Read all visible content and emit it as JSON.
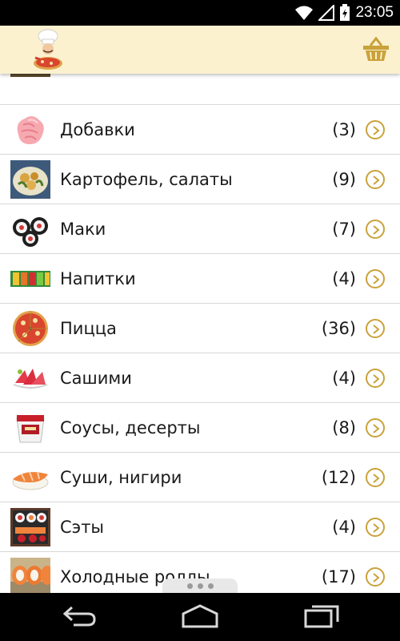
{
  "status_bar": {
    "time": "23:05",
    "icons": [
      "wifi-icon",
      "signal-icon",
      "battery-charging-icon"
    ]
  },
  "app_bar": {
    "logo_icon": "chef-pizza-logo",
    "action_icon": "basket-icon"
  },
  "categories": [
    {
      "name": "Добавки",
      "count": "(3)",
      "icon": "pickled-ginger-icon"
    },
    {
      "name": "Картофель, салаты",
      "count": "(9)",
      "icon": "potato-salad-icon"
    },
    {
      "name": "Маки",
      "count": "(7)",
      "icon": "maki-roll-icon"
    },
    {
      "name": "Напитки",
      "count": "(4)",
      "icon": "drinks-icon"
    },
    {
      "name": "Пицца",
      "count": "(36)",
      "icon": "pizza-icon"
    },
    {
      "name": "Сашими",
      "count": "(4)",
      "icon": "sashimi-icon"
    },
    {
      "name": "Соусы, десерты",
      "count": "(8)",
      "icon": "sauce-dessert-icon"
    },
    {
      "name": "Суши, нигири",
      "count": "(12)",
      "icon": "nigiri-icon"
    },
    {
      "name": "Сэты",
      "count": "(4)",
      "icon": "sushi-set-icon"
    },
    {
      "name": "Холодные роллы",
      "count": "(17)",
      "icon": "cold-roll-icon"
    }
  ],
  "colors": {
    "app_bar_bg": "#fbf1cf",
    "accent": "#c9a23a",
    "divider": "#d8d8d8"
  },
  "nav_bar": {
    "icons": [
      "back-icon",
      "home-icon",
      "recents-icon"
    ]
  }
}
